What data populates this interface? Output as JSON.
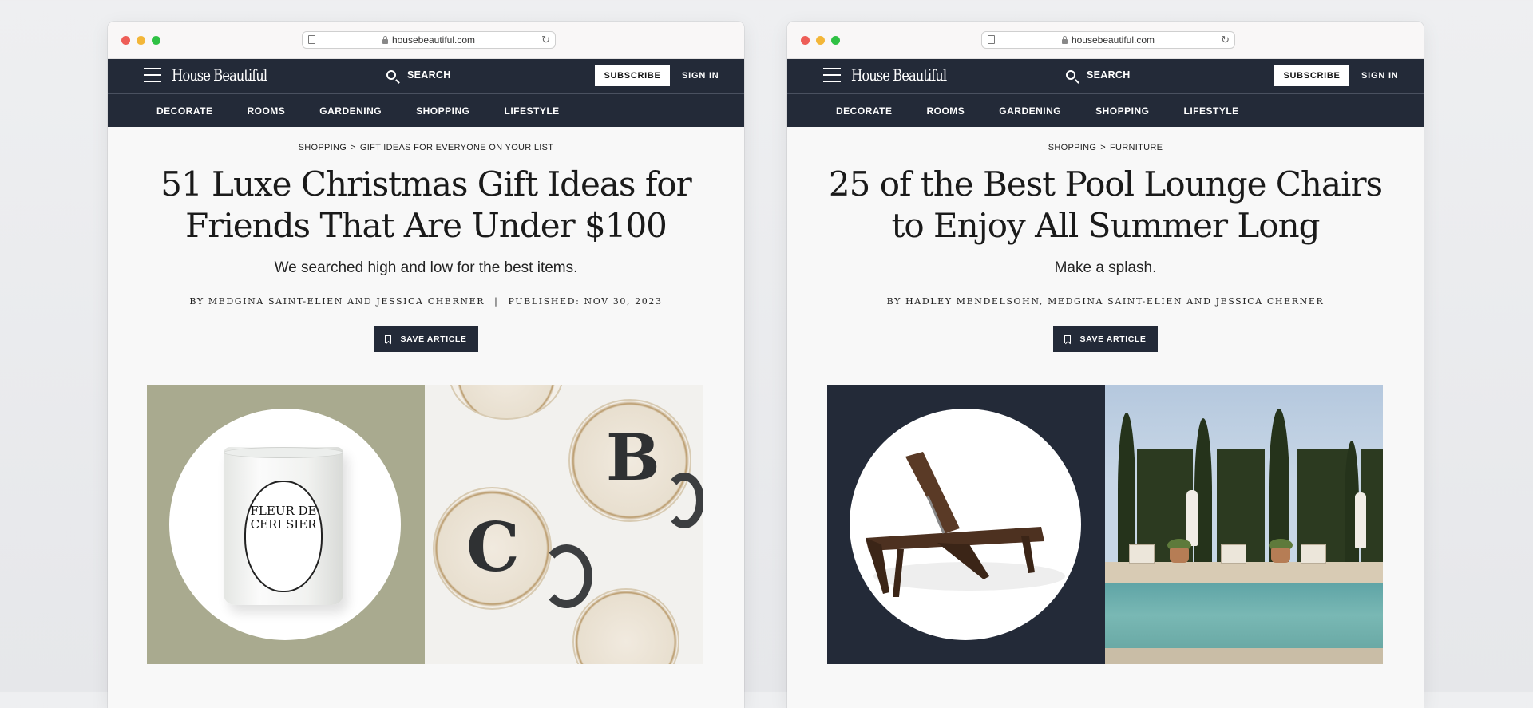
{
  "windows": [
    {
      "url": "housebeautiful.com",
      "brand": "House Beautiful",
      "search_label": "SEARCH",
      "subscribe_label": "SUBSCRIBE",
      "signin_label": "SIGN IN",
      "nav": [
        "DECORATE",
        "ROOMS",
        "GARDENING",
        "SHOPPING",
        "LIFESTYLE"
      ],
      "breadcrumb": [
        "SHOPPING",
        "GIFT IDEAS FOR EVERYONE ON YOUR LIST"
      ],
      "breadcrumb_sep": ">",
      "headline_line1": "51 Luxe Christmas Gift Ideas for",
      "headline_line2": "Friends That Are Under $100",
      "dek": "We searched high and low for the best items.",
      "byline": "BY MEDGINA SAINT-ELIEN AND JESSICA CHERNER",
      "byline_divider": "|",
      "published": "PUBLISHED: NOV 30, 2023",
      "save_label": "SAVE ARTICLE",
      "hero_left_bg": "#a9aa8f",
      "candle_label_text": "FLEUR DE CERI SIER",
      "mug_letters": [
        "B",
        "C"
      ]
    },
    {
      "url": "housebeautiful.com",
      "brand": "House Beautiful",
      "search_label": "SEARCH",
      "subscribe_label": "SUBSCRIBE",
      "signin_label": "SIGN IN",
      "nav": [
        "DECORATE",
        "ROOMS",
        "GARDENING",
        "SHOPPING",
        "LIFESTYLE"
      ],
      "breadcrumb": [
        "SHOPPING",
        "FURNITURE"
      ],
      "breadcrumb_sep": ">",
      "headline_line1": "25 of the Best Pool Lounge Chairs",
      "headline_line2": "to Enjoy All Summer Long",
      "dek": "Make a splash.",
      "byline": "BY HADLEY MENDELSOHN, MEDGINA SAINT-ELIEN AND JESSICA CHERNER",
      "save_label": "SAVE ARTICLE",
      "hero_left_bg": "#232a38"
    }
  ],
  "colors": {
    "nav_bg": "#232a38",
    "dot_red": "#ee5d57",
    "dot_yellow": "#f3b638",
    "dot_green": "#2fc144"
  },
  "icons": [
    "page-icon",
    "lock-icon",
    "reload-icon",
    "menu-icon",
    "search-icon",
    "bookmark-icon"
  ]
}
